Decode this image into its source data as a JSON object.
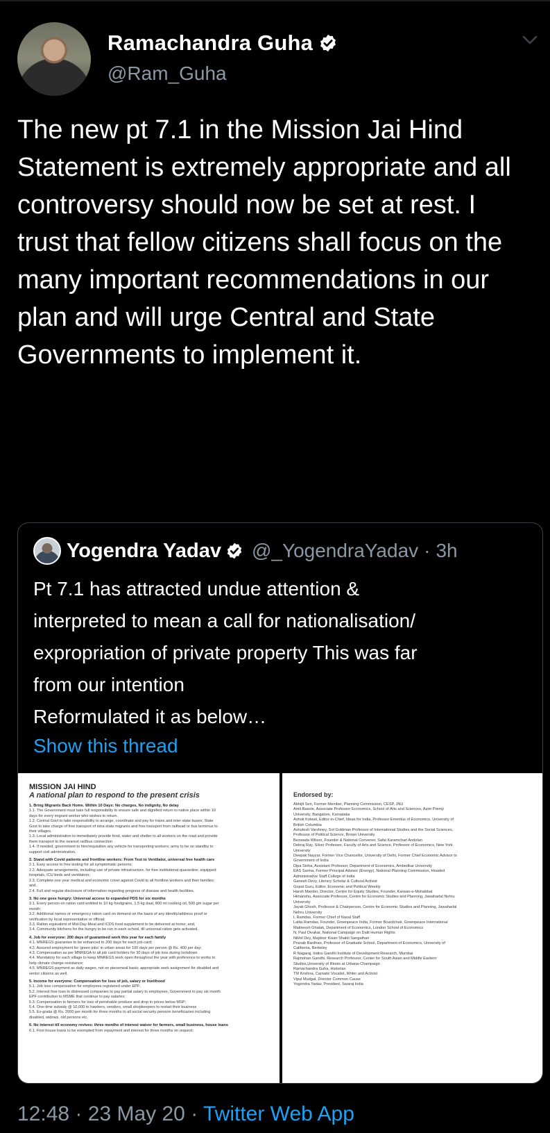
{
  "author": {
    "display_name": "Ramachandra Guha",
    "handle": "@Ram_Guha"
  },
  "tweet": {
    "text": "The new pt 7.1 in the Mission Jai Hind Statement is extremely appropriate and all controversy should now be set at rest. I trust that fellow citizens shall focus on the many important recommendations in our plan and will urge Central and State Governments to implement it."
  },
  "quoted_tweet": {
    "display_name": "Yogendra Yadav",
    "handle": "@_YogendraYadav",
    "separator": "·",
    "time_ago": "3h",
    "text": "Pt 7.1 has attracted undue attention &\ninterpreted to mean a call for nationalisation/\nexpropriation of private property This was far\nfrom our intention\nReformulated it as below…",
    "show_thread_label": "Show this thread"
  },
  "document_left": {
    "title": "MISSION JAI HIND",
    "subtitle": "A national plan to respond to the present crisis",
    "lines": [
      {
        "text": "1.  Bring Migrants Back Home. Within 10 Days: No charges, No indignity, No delay",
        "bold": true
      },
      {
        "text": "1.1. The Government must take full responsibility to ensure safe and dignified return to native place within 10",
        "bold": false
      },
      {
        "text": "days for every migrant worker who wishes to return.",
        "bold": false
      },
      {
        "text": "1.2. Central Govt to take responsibility to arrange, coordinate and pay for trains and inter-state buses; State",
        "bold": false
      },
      {
        "text": "Govt to take charge of free transport of intra-state migrants and free transport from railhead or bus terminus to",
        "bold": false
      },
      {
        "text": "their villages.",
        "bold": false
      },
      {
        "text": "1.3. Local administration to immediately provide food, water and shelter to all workers on the road and provide",
        "bold": false
      },
      {
        "text": "them transport to the nearest rail/bus connection",
        "bold": false
      },
      {
        "text": "1.4. If needed, government to hire/requisition any vehicle for transporting workers; army to be on standby to",
        "bold": false
      },
      {
        "text": "support civil administration.",
        "bold": false
      },
      {
        "text": "2.  Stand with Covid patients and frontline workers: From Test to Ventilator, universal free health care",
        "bold": true
      },
      {
        "text": "2.1. Easy access to free testing for all symptomatic persons;",
        "bold": false
      },
      {
        "text": "2.2. Adequate arrangements, including use of private infrastructure, for free institutional quarantine, equipped",
        "bold": false
      },
      {
        "text": "hospitals, ICU beds and ventilators;",
        "bold": false
      },
      {
        "text": "2.3. Complete one year medical and economic cover against Covid to all frontline workers and their families;",
        "bold": false
      },
      {
        "text": "and,",
        "bold": false
      },
      {
        "text": "2.4. Full and regular disclosure of information regarding progress of disease and health facilities.",
        "bold": false
      },
      {
        "text": "3.  No one goes hungry: Universal access to expanded PDS for six months",
        "bold": true
      },
      {
        "text": "3.1. Every person on ration card entitled to 10 kg foodgrains, 1.5 kg daal, 800 ml cooking oil, 500 gm sugar per",
        "bold": false
      },
      {
        "text": "month;",
        "bold": false
      },
      {
        "text": "3.2. Additional names or emergency ration card on demand on the basis of any identity/address proof or",
        "bold": false
      },
      {
        "text": "verification by local representative or official;",
        "bold": false
      },
      {
        "text": "3.3. Ration equivalent of Mid-Day-Meal and ICDS food supplement to be delivered at home; and,",
        "bold": false
      },
      {
        "text": "3.4. Community kitchens for the hungry to be run in each school, till universal ration gets activated.",
        "bold": false
      },
      {
        "text": "4.  Job for everyone: 200 days of guaranteed work this year for each family",
        "bold": true
      },
      {
        "text": "4.1. MNREGS guarantee to be enhanced to 200 days for each job card;",
        "bold": false
      },
      {
        "text": "4.2. Assured employment for 'green jobs' in urban areas for 100 days per person @ Rs. 400 per day;",
        "bold": false
      },
      {
        "text": "4.3. Compensation as per MNREGA to all job card holders for 30 days of job loss during lockdown",
        "bold": false
      },
      {
        "text": "4.4. Mandatory for each village to keep MNREGS work open throughout the year with preference to works to",
        "bold": false
      },
      {
        "text": "help climate change resistance;",
        "bold": false
      },
      {
        "text": "4.5. MNREGS payment as daily wages, not on piecemeal basis; appropriate work assignment for disabled and",
        "bold": false
      },
      {
        "text": "senior citizens as well.",
        "bold": false
      },
      {
        "text": "5.  Income for everyone: Compensation for loss of job, salary or livelihood",
        "bold": true
      },
      {
        "text": "5.1. Job loss compensation for employees registered under EPF;",
        "bold": false
      },
      {
        "text": "5.2. Interest free loan to distressed companies to pay partial salary to employees; Government to pay six month",
        "bold": false
      },
      {
        "text": "EPF contribution to MSME that continue to pay salaries;",
        "bold": false
      },
      {
        "text": "5.3. Compensation to farmers for loss of perishable produce and drop in prices below MSP;",
        "bold": false
      },
      {
        "text": "5.4. One-time subsidy @ 10,000 to hawkers, vendors, small shopkeepers to restart their business",
        "bold": false
      },
      {
        "text": "5.5. Ex-gratia @ Rs. 2000 per month for three months to all social security pension beneficiaries including",
        "bold": false
      },
      {
        "text": "disabled, widows, old persons etc.",
        "bold": false
      },
      {
        "text": "6.  No interest till economy revives: three months of interest waiver for farmers, small business, house loans",
        "bold": true
      },
      {
        "text": "6.1. First house loans to be exempted from repayment and interest for three months on request;",
        "bold": false
      }
    ]
  },
  "document_right": {
    "title": "Endorsed by:",
    "lines": [
      "Abhijit Sen, Former Member, Planning Commission, CESP, JNU",
      "Amit Basole, Associate Professor Economics, School of Arts and Sciences, Azim Premji",
      "University, Bangalore, Karnataka",
      "Ashok Kotwal, Editor-in-Chief, Ideas for India, Professor Emeritus of Economics, University of",
      "British Columbia",
      "Ashutosh Varshney, Sol Goldman Professor of International Studies and the Social Sciences,",
      "Professor of Political Science, Brown University",
      "Bezwada Wilson, Founder & National Convener, Safai Karamchari Andolan",
      "Debraj Ray, Silver Professor, Faculty of Arts and Science, Professor of Economics, New York",
      "University",
      "Deepak Nayyar, Former Vice Chancellor, University of Delhi, Former Chief Economic Advisor to",
      "Government of India",
      "Dipa Sinha, Assistant Professor, Department of Economics, Ambedkar University",
      "EAS Sarma, Former Principal Advisor (Energy), National Planning Commission, Headed",
      "Administrative Staff College of India",
      "Ganesh Devy, Literary Scholar & Cultural Activist",
      "Gopal Guru, Editor, Economic and Political Weekly",
      "Harsh Mander, Director, Centre for Equity Studies, Founder, Karwan-e-Mohabbat",
      "Himanshu, Associate Professor, Centre for Economic Studies and Planning, Jawaharlal Nehru",
      "University",
      "Jayati Ghosh, Professor & Chairperson, Centre for Economic Studies and Planning, Jawaharlal",
      "Nehru University",
      "L Ramdas, Former Chief of Naval Staff",
      "Lalita Ramdas, Founder, Greenpeace India, Former Boardchair, Greenpeace International",
      "Maitreesh Ghatak, Department of Economics, London School of Economics",
      "N. Paul Divakar, National Campaign on Dalit Human Rights",
      "Nikhil Dey, Majdoor Kisan Shakti Sangathan",
      "Pranab Bardhan, Professor of Graduate School, Department of Economics, University of",
      "California, Berkeley",
      "R Nagaraj, Indira Gandhi Institute of Development Research, Mumbai",
      "Rajmohan Gandhi, Research Professor, Center for South Asian and Middle Eastern",
      "Studies,University of Illinois at Urbana-Champaign",
      "Ramachandra Guha, Historian",
      "TM Krishna, Carnatic Vocalist, Writer and Activist",
      "Vipul Mudgal, Director Common Cause",
      "Yogendra Yadav, President, Swaraj India"
    ]
  },
  "footer": {
    "time": "12:48",
    "separator_1": "·",
    "date": "23 May 20",
    "separator_2": "·",
    "app": "Twitter Web App"
  },
  "icons": {
    "verified": "verified-badge-icon",
    "more": "chevron-down-icon"
  },
  "colors": {
    "background": "#000000",
    "text": "#ffffff",
    "secondary": "#8b98a5",
    "link": "#1da1f2",
    "border": "#3a3f44"
  }
}
